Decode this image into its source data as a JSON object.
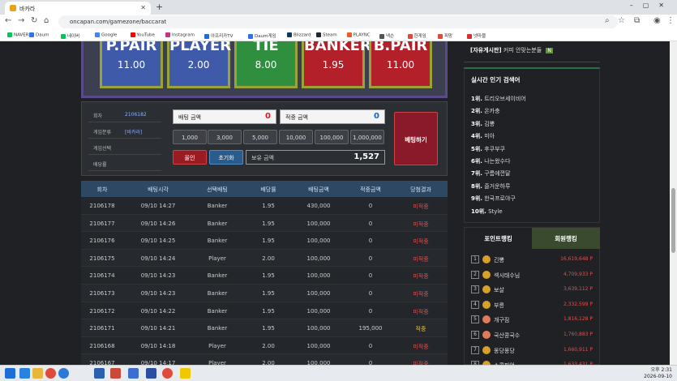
{
  "browser": {
    "tab_title": "바카라",
    "url": "oncapan.com/gamezone/baccarat",
    "bookmarks": [
      "NAVER",
      "Daum",
      "네이버",
      "Google",
      "YouTube",
      "Instagram",
      "아프리카TV",
      "Daum게임",
      "Blizzard",
      "Steam",
      "PLAYNC",
      "넥슨",
      "한게임",
      "피망",
      "넷마블"
    ]
  },
  "board": {
    "bets": [
      {
        "name": "P.PAIR",
        "odds": "11.00",
        "color": "#3f5aa8"
      },
      {
        "name": "PLAYER",
        "odds": "2.00",
        "color": "#3f5aa8"
      },
      {
        "name": "TIE",
        "odds": "8.00",
        "color": "#2f8f3e"
      },
      {
        "name": "BANKER",
        "odds": "1.95",
        "color": "#b3202a"
      },
      {
        "name": "B.PAIR",
        "odds": "11.00",
        "color": "#b3202a"
      }
    ]
  },
  "info": {
    "round_label": "회차",
    "round_value": "2106182",
    "category_label": "게임분류",
    "category_value": "[바카라]",
    "selection_label": "게임선택",
    "odds_label": "배당률"
  },
  "betting": {
    "bet_amount_label": "배팅 금액",
    "bet_amount_value": "0",
    "win_amount_label": "적중 금액",
    "win_amount_value": "0",
    "chips": [
      "1,000",
      "3,000",
      "5,000",
      "10,000",
      "100,000",
      "1,000,000"
    ],
    "allin_label": "올인",
    "reset_label": "초기화",
    "balance_label": "보유 금액",
    "balance_value": "1,527",
    "submit_label": "베팅하기"
  },
  "history": {
    "headers": [
      "회차",
      "배팅시각",
      "선택배팅",
      "배당률",
      "배팅금액",
      "적중금액",
      "당첨결과"
    ],
    "rows": [
      [
        "2106178",
        "09/10 14:27",
        "Banker",
        "1.95",
        "430,000",
        "0",
        "미적중"
      ],
      [
        "2106177",
        "09/10 14:26",
        "Banker",
        "1.95",
        "100,000",
        "0",
        "미적중"
      ],
      [
        "2106176",
        "09/10 14:25",
        "Banker",
        "1.95",
        "100,000",
        "0",
        "미적중"
      ],
      [
        "2106175",
        "09/10 14:24",
        "Player",
        "2.00",
        "100,000",
        "0",
        "미적중"
      ],
      [
        "2106174",
        "09/10 14:23",
        "Banker",
        "1.95",
        "100,000",
        "0",
        "미적중"
      ],
      [
        "2106173",
        "09/10 14:23",
        "Banker",
        "1.95",
        "100,000",
        "0",
        "미적중"
      ],
      [
        "2106172",
        "09/10 14:22",
        "Banker",
        "1.95",
        "100,000",
        "0",
        "미적중"
      ],
      [
        "2106171",
        "09/10 14:21",
        "Banker",
        "1.95",
        "100,000",
        "195,000",
        "적중"
      ],
      [
        "2106168",
        "09/10 14:18",
        "Player",
        "2.00",
        "100,000",
        "0",
        "미적중"
      ],
      [
        "2106167",
        "09/10 14:17",
        "Player",
        "2.00",
        "100,000",
        "0",
        "미적중"
      ]
    ]
  },
  "sidebar": {
    "free_board_label": "[자유게시판]",
    "free_board_post": "커피 안맞는분들",
    "new_badge": "N",
    "popular_title": "실시간 인기 검색어",
    "popular": [
      {
        "rank": "1위.",
        "term": "트리오브세이비어"
      },
      {
        "rank": "2위.",
        "term": "온카충"
      },
      {
        "rank": "3위.",
        "term": "김뽕"
      },
      {
        "rank": "4위.",
        "term": "미아"
      },
      {
        "rank": "5위.",
        "term": "후쿠부쿠"
      },
      {
        "rank": "6위.",
        "term": "나는왔수다"
      },
      {
        "rank": "7위.",
        "term": "구름에껀달"
      },
      {
        "rank": "8위.",
        "term": "즐거운하루"
      },
      {
        "rank": "9위.",
        "term": "한국프로야구"
      },
      {
        "rank": "10위.",
        "term": "Style"
      }
    ],
    "tab_points": "포인트랭킹",
    "tab_members": "회원랭킹",
    "ranking": [
      {
        "n": "1",
        "name": "긴뽕",
        "points": "16,619,648 P"
      },
      {
        "n": "2",
        "name": "섹시태수님",
        "points": "4,709,933 P"
      },
      {
        "n": "3",
        "name": "보살",
        "points": "3,639,112 P"
      },
      {
        "n": "4",
        "name": "부릉",
        "points": "2,332,599 P"
      },
      {
        "n": "5",
        "name": "개구짐",
        "points": "1,816,128 P"
      },
      {
        "n": "6",
        "name": "국산콩국수",
        "points": "1,760,883 P"
      },
      {
        "n": "7",
        "name": "몽당몽당",
        "points": "1,660,911 P"
      },
      {
        "n": "8",
        "name": "스콜피언",
        "points": "1,633,431 P"
      }
    ]
  },
  "taskbar": {
    "time": "오후 2:31",
    "date": "2026-09-10"
  }
}
